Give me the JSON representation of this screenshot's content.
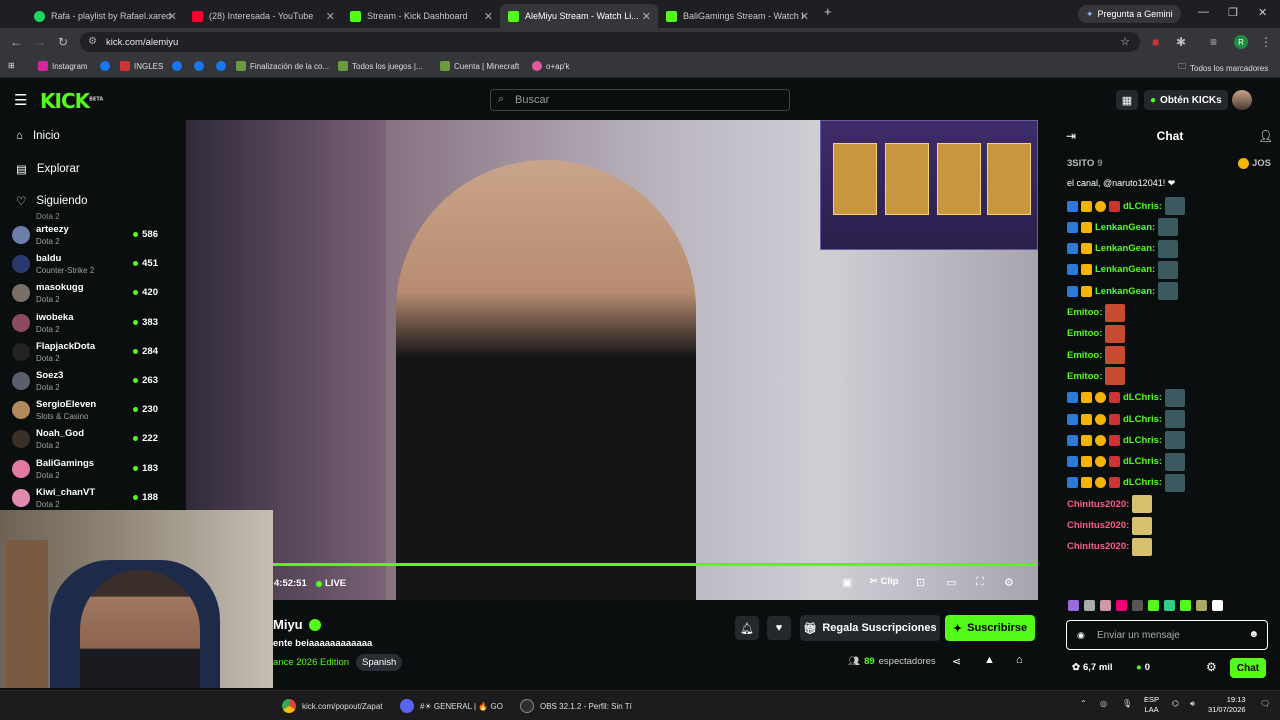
{
  "browser": {
    "tabs": [
      {
        "label": "Rafa - playlist by Rafael.xared |",
        "color": "#1ed760"
      },
      {
        "label": "(28) Interesada - YouTube",
        "color": "#ff0033"
      },
      {
        "label": "Stream - Kick Dashboard",
        "color": "#53fc18"
      },
      {
        "label": "AleMiyu Stream - Watch Li...",
        "color": "#53fc18"
      },
      {
        "label": "BaliGamings Stream - Watch Li...",
        "color": "#53fc18"
      }
    ],
    "gemini_label": "Pregunta a Gemini",
    "url": "kick.com/alemiyu",
    "bookmarks": [
      "Instagram",
      "INGLES",
      "Finalización de la co...",
      "Todos los juegos |...",
      "Cuenta | Minecraft",
      "o+ap'k"
    ],
    "all_bookmarks": "Todos los marcadores"
  },
  "kick": {
    "logo": "KICK",
    "logo_sup": "BETA",
    "search_placeholder": "Buscar",
    "get_kicks": "Obtén KICKs",
    "nav": [
      "Inicio",
      "Explorar",
      "Siguiendo"
    ],
    "following_top_game": "Dota 2",
    "channels": [
      {
        "name": "arteezy",
        "game": "Dota 2",
        "viewers": "586",
        "color": "#6b7fa8"
      },
      {
        "name": "baldu",
        "game": "Counter-Strike 2",
        "viewers": "451",
        "color": "#2a3a6e"
      },
      {
        "name": "masokugg",
        "game": "Dota 2",
        "viewers": "420",
        "color": "#7a6f66"
      },
      {
        "name": "iwobeka",
        "game": "Dota 2",
        "viewers": "383",
        "color": "#8c4a5e"
      },
      {
        "name": "FlapjackDota",
        "game": "Dota 2",
        "viewers": "284",
        "color": "#222"
      },
      {
        "name": "Soez3",
        "game": "Dota 2",
        "viewers": "263",
        "color": "#5a5f6e"
      },
      {
        "name": "SergioEleven",
        "game": "Slots & Casino",
        "viewers": "230",
        "color": "#b08a5a"
      },
      {
        "name": "Noah_God",
        "game": "Dota 2",
        "viewers": "222",
        "color": "#3a3028"
      },
      {
        "name": "BaliGamings",
        "game": "Dota 2",
        "viewers": "183",
        "color": "#e07aa0"
      },
      {
        "name": "Kiwi_chanVT",
        "game": "Dota 2",
        "viewers": "188",
        "color": "#e08ab0"
      }
    ],
    "player": {
      "time": "4:52:51",
      "live": "LIVE",
      "clip": "Clip"
    },
    "stream": {
      "name": "Miyu",
      "title": "ente beiaaaaaaaaaaaa",
      "category": "ance 2026 Edition",
      "tag": "Spanish",
      "gift_label": "Regala Suscripciones",
      "subscribe_label": "Suscribirse",
      "viewers": "89",
      "viewers_label": "espectadores"
    },
    "chat": {
      "title": "Chat",
      "top_user": "3SITO",
      "top_count": "9",
      "top_right": "JOS",
      "line1": "el canal, @naruto12041! ❤",
      "messages": [
        {
          "user": "dLChris:",
          "color": "#53fc18",
          "badges": 4
        },
        {
          "user": "LenkanGean:",
          "color": "#53fc18",
          "badges": 2
        },
        {
          "user": "LenkanGean:",
          "color": "#53fc18",
          "badges": 2
        },
        {
          "user": "LenkanGean:",
          "color": "#53fc18",
          "badges": 2
        },
        {
          "user": "LenkanGean:",
          "color": "#53fc18",
          "badges": 2
        },
        {
          "user": "Emitoo:",
          "color": "#53fc18",
          "badges": 0
        },
        {
          "user": "Emitoo:",
          "color": "#53fc18",
          "badges": 0
        },
        {
          "user": "Emitoo:",
          "color": "#53fc18",
          "badges": 0
        },
        {
          "user": "Emitoo:",
          "color": "#53fc18",
          "badges": 0
        },
        {
          "user": "dLChris:",
          "color": "#53fc18",
          "badges": 4
        },
        {
          "user": "dLChris:",
          "color": "#53fc18",
          "badges": 4
        },
        {
          "user": "dLChris:",
          "color": "#53fc18",
          "badges": 4
        },
        {
          "user": "dLChris:",
          "color": "#53fc18",
          "badges": 4
        },
        {
          "user": "dLChris:",
          "color": "#53fc18",
          "badges": 4
        },
        {
          "user": "Chinitus2020:",
          "color": "#ff5a88",
          "badges": 0
        },
        {
          "user": "Chinitus2020:",
          "color": "#ff5a88",
          "badges": 0
        },
        {
          "user": "Chinitus2020:",
          "color": "#ff5a88",
          "badges": 0
        }
      ],
      "input_placeholder": "Enviar un mensaje",
      "kicks": "6,7 mil",
      "points": "0",
      "send": "Chat"
    }
  },
  "taskbar": {
    "items": [
      "kick.com/popout/Zapat",
      "#☀ GENERAL | 🔥 GO",
      "OBS 32.1.2 - Perfil: Sin Tí"
    ],
    "lang": "ESP",
    "lang2": "LAA",
    "time": "19:13",
    "date": "31/07/2026"
  },
  "colors": {
    "accent": "#53fc18",
    "background": "#0b0e0f"
  }
}
